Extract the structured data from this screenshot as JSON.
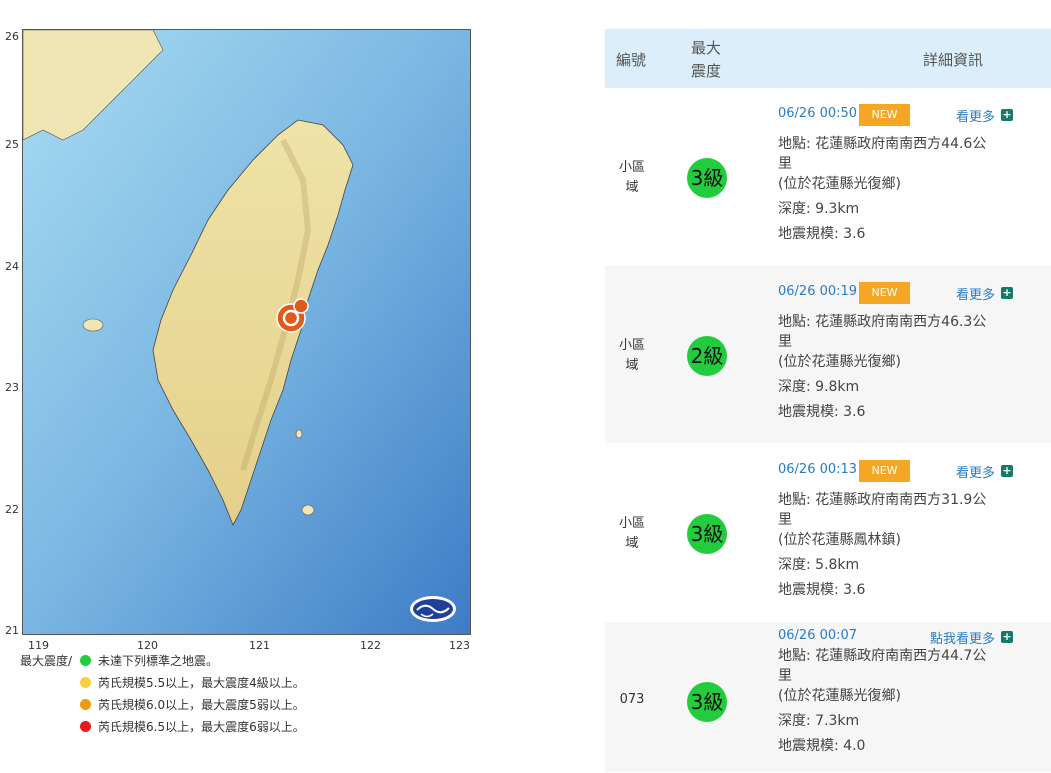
{
  "map": {
    "y_ticks": [
      "26",
      "25",
      "24",
      "23",
      "22",
      "21"
    ],
    "x_ticks": [
      "119",
      "120",
      "121",
      "122",
      "123"
    ],
    "logo_icon": "weather-bureau-logo-icon",
    "epicenter_icon": "epicenter-marker-icon"
  },
  "legend": {
    "title": "最大震度/",
    "items": [
      {
        "color": "#22cc3c",
        "label": "未達下列標準之地震。"
      },
      {
        "color": "#f5d042",
        "label": "芮氏規模5.5以上，最大震度4級以上。"
      },
      {
        "color": "#f09a10",
        "label": "芮氏規模6.0以上，最大震度5弱以上。"
      },
      {
        "color": "#e31b1b",
        "label": "芮氏規模6.5以上，最大震度6弱以上。"
      }
    ]
  },
  "table": {
    "headers": {
      "id": "編號",
      "intensity_line1": "最大",
      "intensity_line2": "震度",
      "detail": "詳細資訊"
    },
    "rows": [
      {
        "area_line1": "小區",
        "area_line2": "域",
        "intensity": "3級",
        "time": "06/26 00:50",
        "new": "NEW",
        "more": "看更多",
        "location": "地點: 花蓮縣政府南南西方44.6公",
        "location2": "里",
        "place": "(位於花蓮縣光復鄉)",
        "depth": "深度: 9.3km",
        "magnitude": "地震規模: 3.6"
      },
      {
        "area_line1": "小區",
        "area_line2": "域",
        "intensity": "2級",
        "time": "06/26 00:19",
        "new": "NEW",
        "more": "看更多",
        "location": "地點: 花蓮縣政府南南西方46.3公",
        "location2": "里",
        "place": "(位於花蓮縣光復鄉)",
        "depth": "深度: 9.8km",
        "magnitude": "地震規模: 3.6"
      },
      {
        "area_line1": "小區",
        "area_line2": "域",
        "intensity": "3級",
        "time": "06/26 00:13",
        "new": "NEW",
        "more": "看更多",
        "location": "地點: 花蓮縣政府南南西方31.9公",
        "location2": "里",
        "place": "(位於花蓮縣鳳林鎮)",
        "depth": "深度: 5.8km",
        "magnitude": "地震規模: 3.6"
      },
      {
        "area_line1": "073",
        "area_line2": "",
        "intensity": "3級",
        "time": "06/26 00:07",
        "new": "",
        "more": "點我看更多",
        "location": "地點: 花蓮縣政府南南西方44.7公",
        "location2": "里",
        "place": "(位於花蓮縣光復鄉)",
        "depth": "深度: 7.3km",
        "magnitude": "地震規模: 4.0"
      }
    ]
  }
}
